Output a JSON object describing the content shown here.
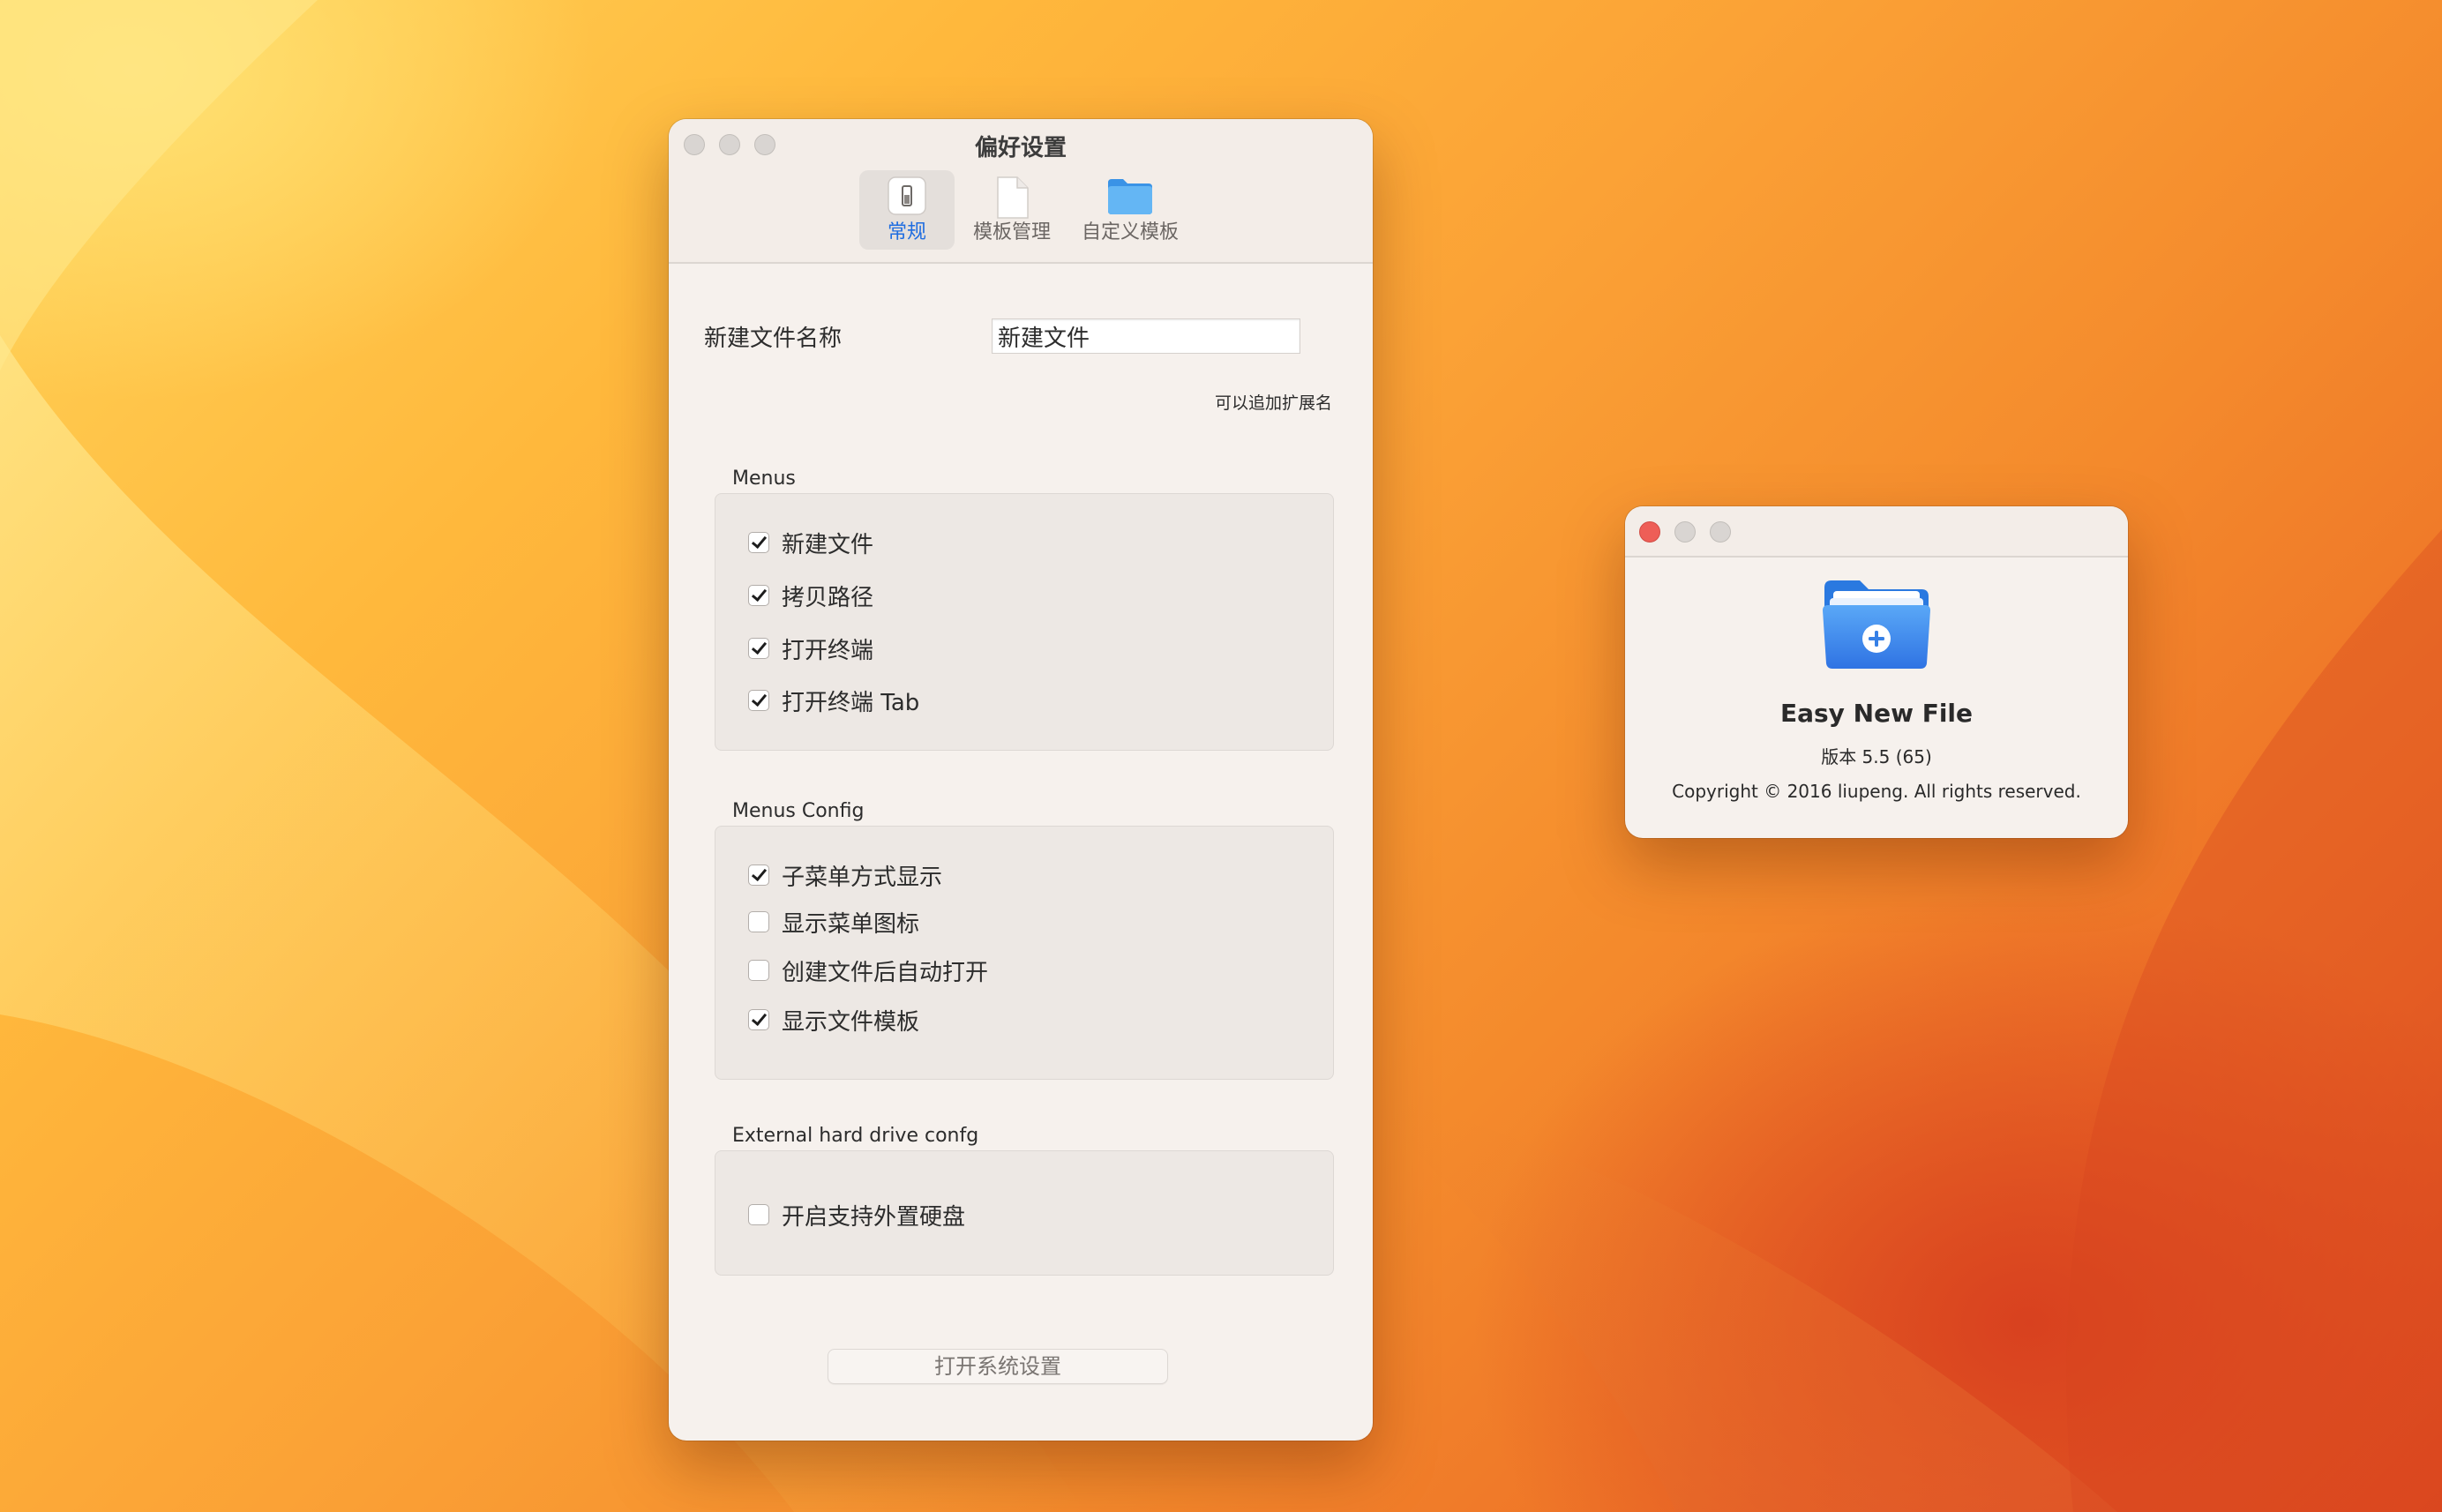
{
  "preferences_window": {
    "title": "偏好设置",
    "toolbar": [
      {
        "label": "常规",
        "icon": "switch-icon",
        "selected": true
      },
      {
        "label": "模板管理",
        "icon": "document-icon",
        "selected": false
      },
      {
        "label": "自定义模板",
        "icon": "folder-icon",
        "selected": false
      }
    ],
    "file_name": {
      "label": "新建文件名称",
      "value": "新建文件",
      "hint": "可以追加扩展名"
    },
    "menus": {
      "title": "Menus",
      "items": [
        {
          "label": "新建文件",
          "checked": true
        },
        {
          "label": "拷贝路径",
          "checked": true
        },
        {
          "label": "打开终端",
          "checked": true
        },
        {
          "label": "打开终端 Tab",
          "checked": true
        }
      ]
    },
    "menus_config": {
      "title": "Menus Config",
      "items": [
        {
          "label": "子菜单方式显示",
          "checked": true
        },
        {
          "label": "显示菜单图标",
          "checked": false
        },
        {
          "label": "创建文件后自动打开",
          "checked": false
        },
        {
          "label": "显示文件模板",
          "checked": true
        }
      ]
    },
    "external_drive": {
      "title": "External hard drive confg",
      "items": [
        {
          "label": "开启支持外置硬盘",
          "checked": false
        }
      ]
    },
    "open_settings_button": "打开系统设置"
  },
  "about_window": {
    "app_name": "Easy New File",
    "version": "版本 5.5 (65)",
    "copyright": "Copyright © 2016 liupeng. All rights reserved.",
    "icon": "folder-plus-icon"
  },
  "colors": {
    "accent": "#1f6de0",
    "window_bg": "#f6f1ed",
    "close_red": "#ee5e57",
    "folder_blue": "#3f8df2"
  }
}
